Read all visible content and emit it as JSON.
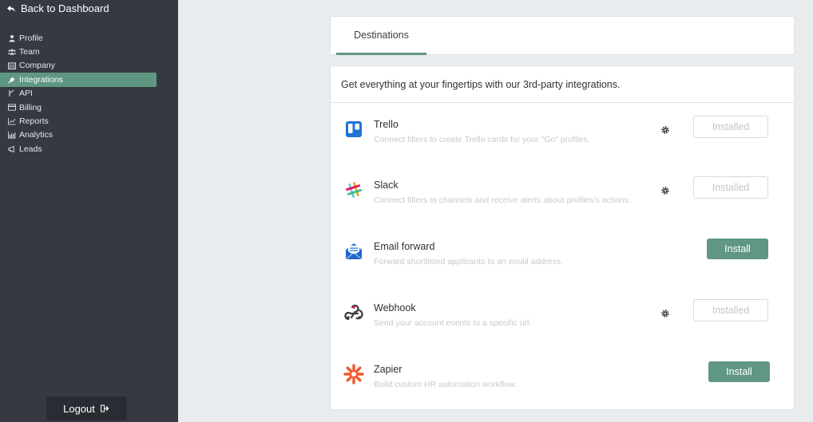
{
  "sidebar": {
    "back_label": "Back to Dashboard",
    "items": [
      {
        "label": "Profile",
        "icon": "person-icon"
      },
      {
        "label": "Team",
        "icon": "team-icon"
      },
      {
        "label": "Company",
        "icon": "building-icon"
      },
      {
        "label": "Integrations",
        "icon": "plug-icon",
        "active": true
      },
      {
        "label": "API",
        "icon": "api-icon"
      },
      {
        "label": "Billing",
        "icon": "credit-card-icon"
      },
      {
        "label": "Reports",
        "icon": "line-chart-icon"
      },
      {
        "label": "Analytics",
        "icon": "bar-chart-icon"
      },
      {
        "label": "Leads",
        "icon": "megaphone-icon"
      }
    ],
    "logout_label": "Logout"
  },
  "tabs": [
    {
      "label": "Destinations",
      "active": true
    }
  ],
  "intro": "Get everything at your fingertips with our 3rd-party integrations.",
  "integrations": [
    {
      "name": "Trello",
      "description": "Connect filters to create Trello cards for your \"Go\" profiles.",
      "status": "Installed",
      "icon": "trello-icon"
    },
    {
      "name": "Slack",
      "description": "Connect filters to channels and receive alerts about profiles's actions.",
      "status": "Installed",
      "icon": "slack-icon"
    },
    {
      "name": "Email forward",
      "description": "Forward shortlisted applicants to an email address.",
      "status": "Install",
      "icon": "email-icon"
    },
    {
      "name": "Webhook",
      "description": "Send your account events to a specific url.",
      "status": "Installed",
      "icon": "webhook-icon"
    },
    {
      "name": "Zapier",
      "description": "Build custom HR automation workflow.",
      "status": "Install",
      "icon": "zapier-icon"
    }
  ],
  "colors": {
    "sidebar_bg": "#363942",
    "accent": "#5f9783",
    "page_bg": "#e9ecef",
    "trello": "#1f74d6",
    "email": "#2d7be5",
    "zapier": "#f0572a"
  }
}
